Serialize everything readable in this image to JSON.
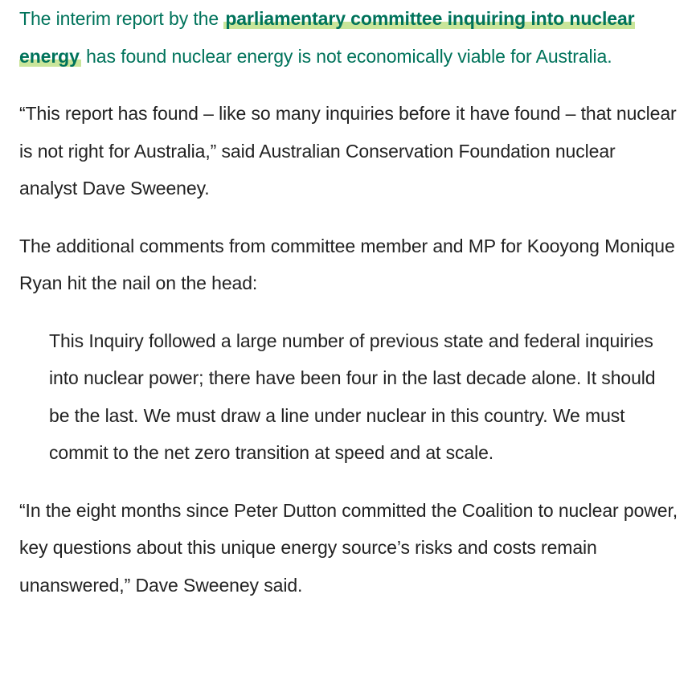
{
  "article": {
    "lead": {
      "before": "The interim report by the ",
      "link": "parliamentary committee inquiring into nuclear energy",
      "after": " has found nuclear energy is not economically viable for Australia."
    },
    "paragraph_1": "“This report has found – like so many inquiries before it have found – that nuclear is not right for Australia,” said Australian Conservation Foundation nuclear analyst Dave Sweeney.",
    "paragraph_2": "The additional comments from committee member and MP for Kooyong Monique Ryan hit the nail on the head:",
    "blockquote": "This Inquiry followed a large number of previous state and federal inquiries into nuclear power; there have been four in the last decade alone. It should be the last. We must draw a line under nuclear in this country. We must commit to the net zero transition at speed and at scale.",
    "paragraph_3": "“In the eight months since Peter Dutton committed the Coalition to nuclear power, key questions about this unique energy source’s risks and costs remain unanswered,” Dave Sweeney said."
  },
  "colors": {
    "lead_text": "#00735b",
    "link_highlight": "#c9e59a",
    "body_text": "#222222"
  }
}
